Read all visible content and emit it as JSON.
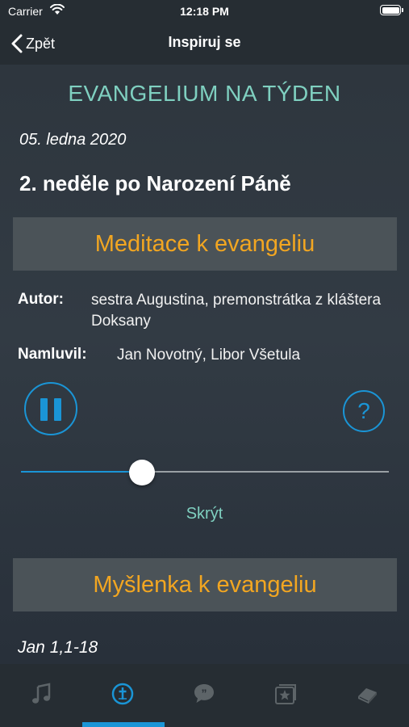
{
  "status_bar": {
    "carrier": "Carrier",
    "time": "12:18 PM"
  },
  "nav": {
    "back_label": "Zpět",
    "title": "Inspiruj se"
  },
  "main": {
    "heading": "EVANGELIUM NA TÝDEN",
    "date": "05. ledna 2020",
    "sunday": "2. neděle po Narození Páně",
    "meditation_title": "Meditace k evangeliu",
    "author_label": "Autor:",
    "author_value": "sestra Augustina, premonstrátka z kláštera Doksany",
    "narrator_label": "Namluvil:",
    "narrator_value": "Jan Novotný, Libor Všetula",
    "help_symbol": "?",
    "playback_progress": 0.33,
    "hide_label": "Skrýt",
    "thought_title": "Myšlenka k evangeliu",
    "reference": "Jan 1,1-18"
  },
  "tabs": [
    {
      "icon": "music-note-icon",
      "active": false
    },
    {
      "icon": "cross-icon",
      "active": true
    },
    {
      "icon": "quote-icon",
      "active": false
    },
    {
      "icon": "star-card-icon",
      "active": false
    },
    {
      "icon": "book-icon",
      "active": false
    }
  ],
  "colors": {
    "accent": "#1a95d6",
    "heading": "#7fd0c0",
    "section_title": "#f2a621",
    "section_bar": "#4b5358",
    "background": "#2b333a"
  }
}
